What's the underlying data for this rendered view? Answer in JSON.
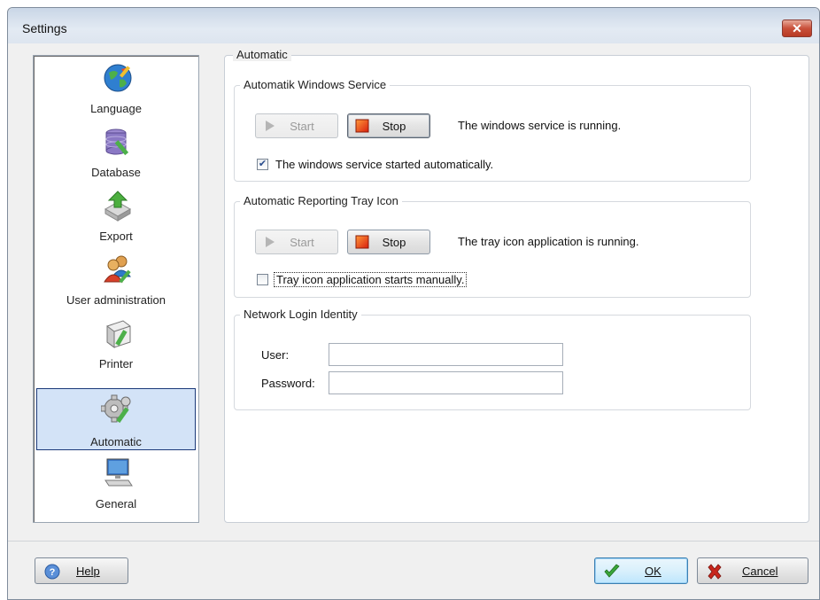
{
  "window": {
    "title": "Settings",
    "close_icon": "close-icon"
  },
  "sidebar": {
    "items": [
      {
        "label": "Language",
        "icon": "globe-icon",
        "selected": false
      },
      {
        "label": "Database",
        "icon": "database-icon",
        "selected": false
      },
      {
        "label": "Export",
        "icon": "export-icon",
        "selected": false
      },
      {
        "label": "User administration",
        "icon": "users-icon",
        "selected": false
      },
      {
        "label": "Printer",
        "icon": "printer-icon",
        "selected": false
      },
      {
        "label": "Automatic",
        "icon": "gear-icon",
        "selected": true
      },
      {
        "label": "General",
        "icon": "computer-icon",
        "selected": false
      }
    ]
  },
  "main": {
    "title": "Automatic",
    "service_group": {
      "title": "Automatik Windows Service",
      "start_label": "Start",
      "stop_label": "Stop",
      "status": "The windows service is running.",
      "checkbox_label": "The windows service started automatically.",
      "checkbox_checked": true
    },
    "tray_group": {
      "title": "Automatic Reporting Tray Icon",
      "start_label": "Start",
      "stop_label": "Stop",
      "status": "The tray icon application is running.",
      "checkbox_label": "Tray icon application starts manually.",
      "checkbox_checked": false
    },
    "login_group": {
      "title": "Network Login Identity",
      "user_label": "User:",
      "user_value": "",
      "password_label": "Password:",
      "password_value": ""
    }
  },
  "footer": {
    "help_label": "Help",
    "ok_label": "OK",
    "cancel_label": "Cancel"
  },
  "colors": {
    "selection_bg": "#d3e3f7",
    "selection_border": "#1c3a7a",
    "stop_red": "#e23a12",
    "ok_green": "#3aa63a",
    "cancel_red": "#c8261c"
  }
}
